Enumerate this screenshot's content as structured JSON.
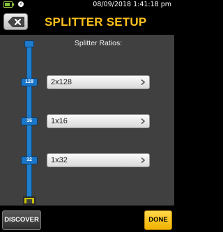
{
  "status": {
    "datetime": "08/09/2018  1:41:18 pm",
    "battery_icon": "battery-icon",
    "plug_icon": "plug-icon"
  },
  "header": {
    "title": "SPLITTER SETUP",
    "back_icon": "back-x-icon",
    "title_color": "#ffc21a"
  },
  "main": {
    "ratios_label": "Splitter Ratios:",
    "splitters": [
      {
        "node_label": "128",
        "value": "2x128"
      },
      {
        "node_label": "16",
        "value": "1x16"
      },
      {
        "node_label": "32",
        "value": "1x32"
      }
    ]
  },
  "footer": {
    "discover_label": "DISCOVER",
    "done_label": "DONE",
    "done_color": "#f2b200"
  }
}
